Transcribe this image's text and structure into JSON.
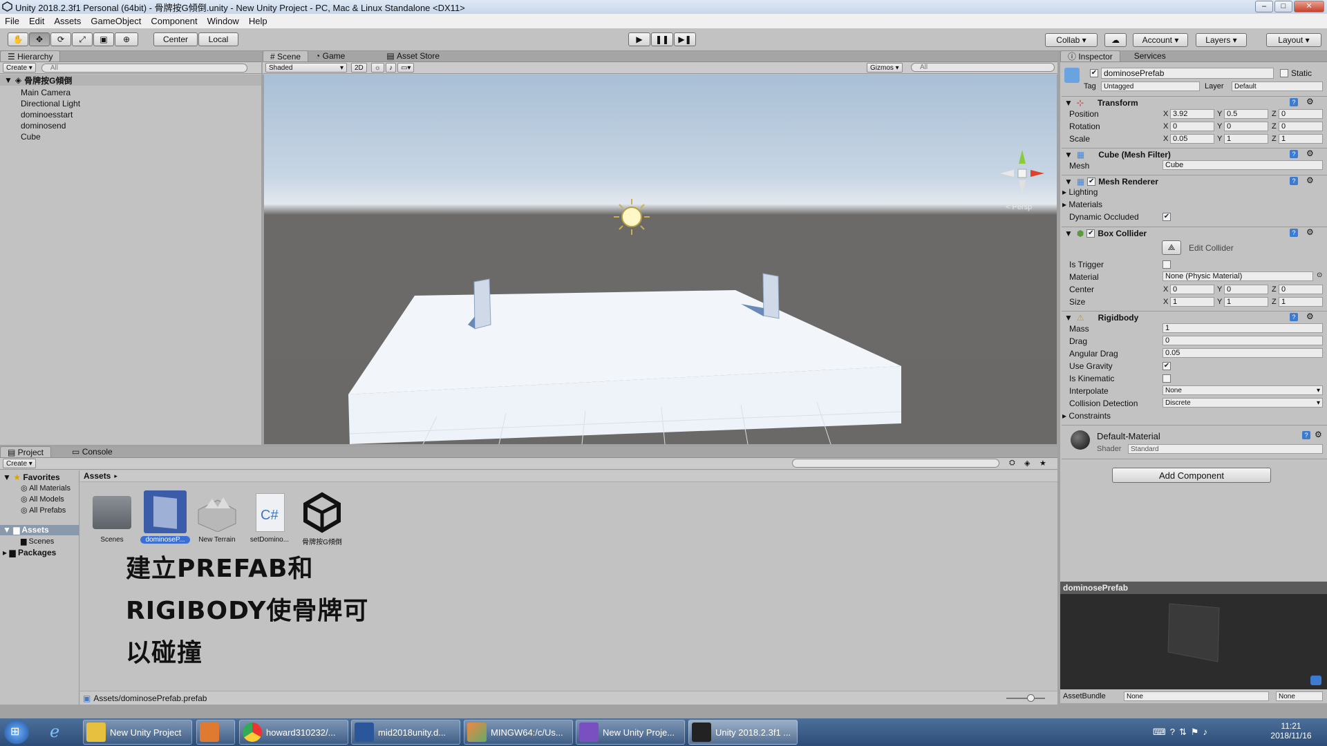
{
  "window": {
    "title": "Unity 2018.2.3f1 Personal (64bit) - 骨牌按G傾倒.unity - New Unity Project - PC, Mac & Linux Standalone <DX11>"
  },
  "menu": [
    "File",
    "Edit",
    "Assets",
    "GameObject",
    "Component",
    "Window",
    "Help"
  ],
  "toolbar": {
    "center_label": "Center",
    "local_label": "Local",
    "collab_label": "Collab",
    "account_label": "Account",
    "layers_label": "Layers",
    "layout_label": "Layout"
  },
  "hierarchy": {
    "tab": "Hierarchy",
    "create": "Create",
    "search_placeholder": "All",
    "scene_name": "骨牌按G傾倒",
    "items": [
      "Main Camera",
      "Directional Light",
      "dominoesstart",
      "dominosend",
      "Cube"
    ]
  },
  "scene": {
    "tabs": [
      "Scene",
      "Game",
      "Asset Store"
    ],
    "shading": "Shaded",
    "mode_2d": "2D",
    "gizmos": "Gizmos",
    "search_placeholder": "All",
    "persp": "< Persp"
  },
  "inspector": {
    "tabs": [
      "Inspector",
      "Services"
    ],
    "object_name": "dominosePrefab",
    "static_label": "Static",
    "tag_label": "Tag",
    "tag_value": "Untagged",
    "layer_label": "Layer",
    "layer_value": "Default",
    "transform": {
      "title": "Transform",
      "position_label": "Position",
      "position": [
        "3.92",
        "0.5",
        "0"
      ],
      "rotation_label": "Rotation",
      "rotation": [
        "0",
        "0",
        "0"
      ],
      "scale_label": "Scale",
      "scale": [
        "0.05",
        "1",
        "1"
      ]
    },
    "mesh_filter": {
      "title": "Cube (Mesh Filter)",
      "mesh_label": "Mesh",
      "mesh_value": "Cube"
    },
    "mesh_renderer": {
      "title": "Mesh Renderer",
      "lighting": "Lighting",
      "materials": "Materials",
      "dynamic_occluded": "Dynamic Occluded"
    },
    "box_collider": {
      "title": "Box Collider",
      "edit_collider": "Edit Collider",
      "is_trigger": "Is Trigger",
      "material_label": "Material",
      "material_value": "None (Physic Material)",
      "center_label": "Center",
      "center": [
        "0",
        "0",
        "0"
      ],
      "size_label": "Size",
      "size": [
        "1",
        "1",
        "1"
      ]
    },
    "rigidbody": {
      "title": "Rigidbody",
      "mass_label": "Mass",
      "mass": "1",
      "drag_label": "Drag",
      "drag": "0",
      "angular_drag_label": "Angular Drag",
      "angular_drag": "0.05",
      "use_gravity": "Use Gravity",
      "is_kinematic": "Is Kinematic",
      "interpolate_label": "Interpolate",
      "interpolate": "None",
      "collision_label": "Collision Detection",
      "collision": "Discrete",
      "constraints": "Constraints"
    },
    "material": {
      "name": "Default-Material",
      "shader_label": "Shader",
      "shader": "Standard"
    },
    "add_component": "Add Component",
    "preview_title": "dominosePrefab",
    "assetbundle_label": "AssetBundle",
    "assetbundle_value": "None",
    "assetbundle_variant": "None"
  },
  "project": {
    "tabs": [
      "Project",
      "Console"
    ],
    "create": "Create",
    "favorites": "Favorites",
    "fav_items": [
      "All Materials",
      "All Models",
      "All Prefabs"
    ],
    "assets": "Assets",
    "asset_children": [
      "Scenes"
    ],
    "packages": "Packages",
    "breadcrumb": "Assets",
    "asset_items": [
      "Scenes",
      "dominoseP...",
      "New Terrain",
      "setDomino...",
      "骨牌按G傾倒"
    ],
    "footer_path": "Assets/dominosePrefab.prefab",
    "overlay_lines": [
      "建立PREFAB和",
      "RIGIBODY使骨牌可",
      "以碰撞"
    ]
  },
  "taskbar": {
    "items": [
      "New Unity Project",
      "",
      "howard310232/...",
      "mid2018unity.d...",
      "MINGW64:/c/Us...",
      "New Unity Proje...",
      "Unity 2018.2.3f1 ..."
    ],
    "time": "11:21",
    "date": "2018/11/16"
  }
}
